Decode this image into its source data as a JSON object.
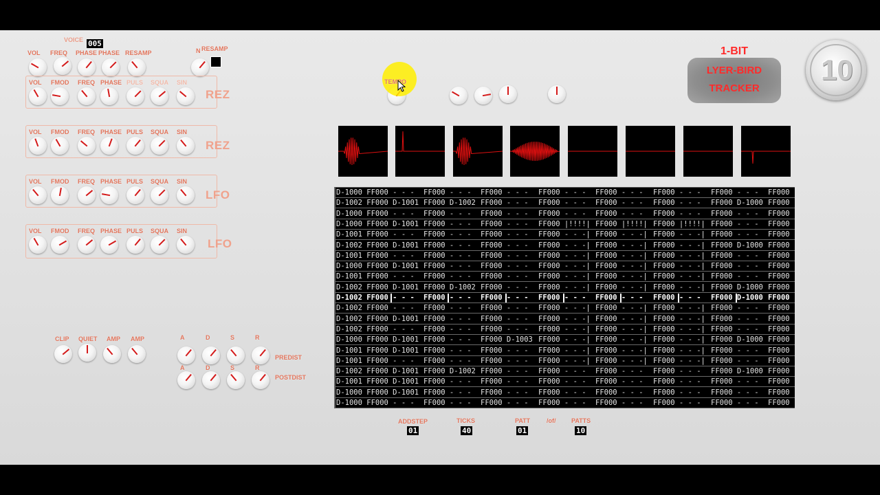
{
  "header": {
    "voice_label": "VOICE",
    "voice_value": "005",
    "resamp_label": "RESAMP",
    "n_label": "N"
  },
  "osc_labels": [
    "VOL",
    "FREQ",
    "PHASE",
    "PHASE",
    "RESAMP"
  ],
  "rows": [
    {
      "title": "REZ",
      "labels": [
        "VOL",
        "FMOD",
        "FREQ",
        "PHASE",
        "PULS",
        "SQUA",
        "SIN"
      ]
    },
    {
      "title": "REZ",
      "labels": [
        "VOL",
        "FMOD",
        "FREQ",
        "PHASE",
        "PULS",
        "SQUA",
        "SIN"
      ]
    },
    {
      "title": "LFO",
      "labels": [
        "VOL",
        "FMOD",
        "FREQ",
        "PHASE",
        "PULS",
        "SQUA",
        "SIN"
      ]
    },
    {
      "title": "LFO",
      "labels": [
        "VOL",
        "FMOD",
        "FREQ",
        "PHASE",
        "PULS",
        "SQUA",
        "SIN"
      ]
    }
  ],
  "dist": {
    "labels": [
      "CLIP",
      "QUIET",
      "AMP",
      "AMP"
    ]
  },
  "adsr": {
    "labels": [
      "A",
      "D",
      "S",
      "R"
    ],
    "predist": "PREDIST",
    "postdist": "POSTDIST"
  },
  "tempo_label": "TEMPO",
  "logo": {
    "line1": "1-BIT",
    "line2": "LYER-BIRD",
    "line3": "TRACKER"
  },
  "coin_text": "10",
  "footer": {
    "addstep_label": "ADDSTEP",
    "addstep_value": "01",
    "ticks_label": "TICKS",
    "ticks_value": "40",
    "patt_label": "PATT",
    "of_label": "/of/",
    "patt_value": "01",
    "patts_label": "PATTS",
    "patts_value": "10"
  },
  "pattern_rows": [
    [
      "D-1000 FF000 - - -",
      "FF000 - - -",
      "FF000 - - -",
      "FF000 - - -",
      "FF000 - - -",
      "FF000 - - -",
      "FF000 - - -",
      "FF000"
    ],
    [
      "D-1002 FF000 D-1001",
      "FF000 D-1002",
      "FF000 - - -",
      "FF000 - - -",
      "FF000 - - -",
      "FF000 - - -",
      "FF000 D-1000",
      "FF000"
    ],
    [
      "D-1000 FF000 - - -",
      "FF000 - - -",
      "FF000 - - -",
      "FF000 - - -",
      "FF000 - - -",
      "FF000 - - -",
      "FF000 - - -",
      "FF000"
    ],
    [
      "D-1000 FF000 D-1001",
      "FF000 - - -",
      "FF000 - - -",
      "FF000 |!!!!|",
      "FF000 |!!!!|",
      "FF000 |!!!!|",
      "FF000 - - -",
      "FF000"
    ],
    [
      "D-1001 FF000 - - -",
      "FF000 - - -",
      "FF000 - - -",
      "FF000 - - -|",
      "FF000 - - -|",
      "FF000 - - -|",
      "FF000 - - -",
      "FF000"
    ],
    [
      "D-1002 FF000 D-1001",
      "FF000 - - -",
      "FF000 - - -",
      "FF000 - - -|",
      "FF000 - - -|",
      "FF000 - - -|",
      "FF000 D-1000",
      "FF000"
    ],
    [
      "D-1001 FF000 - - -",
      "FF000 - - -",
      "FF000 - - -",
      "FF000 - - -|",
      "FF000 - - -|",
      "FF000 - - -|",
      "FF000 - - -",
      "FF000"
    ],
    [
      "D-1000 FF000 D-1001",
      "FF000 - - -",
      "FF000 - - -",
      "FF000 - - -|",
      "FF000 - - -|",
      "FF000 - - -|",
      "FF000 - - -",
      "FF000"
    ],
    [
      "D-1001 FF000 - - -",
      "FF000 - - -",
      "FF000 - - -",
      "FF000 - - -|",
      "FF000 - - -|",
      "FF000 - - -|",
      "FF000 - - -",
      "FF000"
    ],
    [
      "D-1002 FF000 D-1001",
      "FF000 D-1002",
      "FF000 - - -",
      "FF000 - - -|",
      "FF000 - - -|",
      "FF000 - - -|",
      "FF000 D-1000",
      "FF000"
    ],
    [
      "D-1002 FF000 - - -",
      "FF000 - - -",
      "FF000 - - -",
      "FF000 - - -",
      "FF000 - - -",
      "FF000 - - -",
      "FF000 D-1000",
      "FF000"
    ],
    [
      "D-1002 FF000 - - -",
      "FF000 - - -",
      "FF000 - - -",
      "FF000 - - -|",
      "FF000 - - -|",
      "FF000 - - -|",
      "FF000 - - -",
      "FF000"
    ],
    [
      "D-1002 FF000 D-1001",
      "FF000 - - -",
      "FF000 - - -",
      "FF000 - - -|",
      "FF000 - - -|",
      "FF000 - - -|",
      "FF000 - - -",
      "FF000"
    ],
    [
      "D-1002 FF000 - - -",
      "FF000 - - -",
      "FF000 - - -",
      "FF000 - - -|",
      "FF000 - - -|",
      "FF000 - - -|",
      "FF000 - - -",
      "FF000"
    ],
    [
      "D-1000 FF000 D-1001",
      "FF000 - - -",
      "FF000 D-1003",
      "FF000 - - -|",
      "FF000 - - -|",
      "FF000 - - -|",
      "FF000 D-1000",
      "FF000"
    ],
    [
      "D-1001 FF000 D-1001",
      "FF000 - - -",
      "FF000 - - -",
      "FF000 - - -|",
      "FF000 - - -|",
      "FF000 - - -|",
      "FF000 - - -",
      "FF000"
    ],
    [
      "D-1001 FF000 - - -",
      "FF000 - - -",
      "FF000 - - -",
      "FF000 - - -|",
      "FF000 - - -|",
      "FF000 - - -|",
      "FF000 - - -",
      "FF000"
    ],
    [
      "D-1002 FF000 D-1001",
      "FF000 D-1002",
      "FF000 - - -",
      "FF000 - - -",
      "FF000 - - -",
      "FF000 - - -",
      "FF000 D-1000",
      "FF000"
    ],
    [
      "D-1001 FF000 D-1001",
      "FF000 - - -",
      "FF000 - - -",
      "FF000 - - -",
      "FF000 - - -",
      "FF000 - - -",
      "FF000 - - -",
      "FF000"
    ],
    [
      "D-1000 FF000 D-1001",
      "FF000 - - -",
      "FF000 - - -",
      "FF000 - - -",
      "FF000 - - -",
      "FF000 - - -",
      "FF000 - - -",
      "FF000"
    ],
    [
      "D-1000 FF000 - - -",
      "FF000 - - -",
      "FF000 - - -",
      "FF000 - - -",
      "FF000 - - -",
      "FF000 - - -",
      "FF000 - - -",
      "FF000"
    ]
  ],
  "current_row_index": 10,
  "colors": {
    "accent": "#e0735a",
    "knob_indicator": "#d41a1a",
    "scope_trace": "#e01010",
    "logo_text": "#ff2a2a"
  }
}
